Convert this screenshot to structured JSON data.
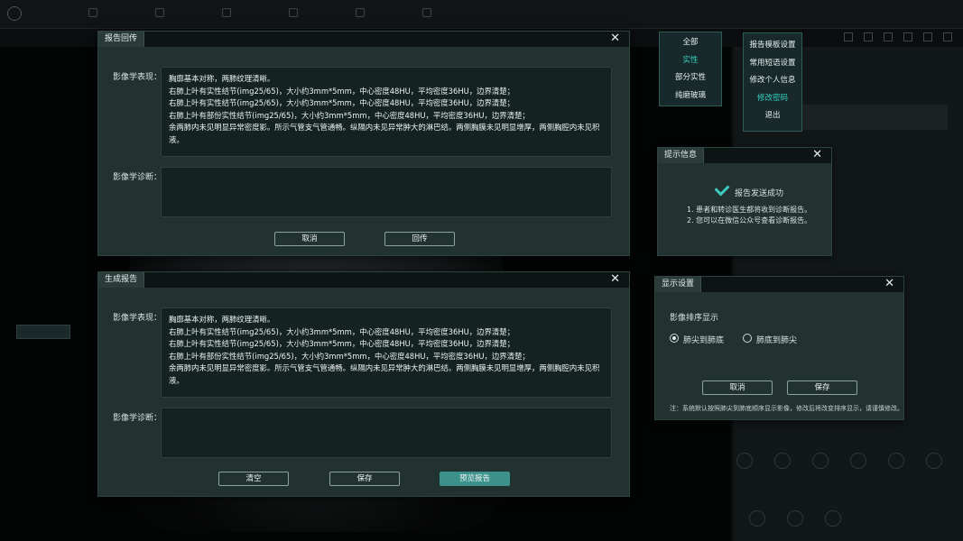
{
  "report_return": {
    "title": "报告回传",
    "findings_label": "影像学表现：",
    "findings_lines": [
      "胸廓基本对称，两肺纹理清晰。",
      "右肺上叶有实性结节(img25/65)，大小约3mm*5mm，中心密度48HU，平均密度36HU，边界清楚；",
      "右肺上叶有实性结节(img25/65)，大小约3mm*5mm，中心密度48HU，平均密度36HU，边界清楚；",
      "右肺上叶有部份实性结节(img25/65)，大小约3mm*5mm，中心密度48HU，平均密度36HU，边界清楚；",
      "余两肺内未见明显异常密度影。所示气管支气管通畅。纵隔内未见异常肿大的淋巴结。两侧胸膜未见明显增厚，两侧胸腔内未见积液。"
    ],
    "diagnosis_label": "影像学诊断：",
    "cancel": "取消",
    "return_btn": "回传"
  },
  "generate_report": {
    "title": "生成报告",
    "findings_label": "影像学表现：",
    "findings_lines": [
      "胸廓基本对称，两肺纹理清晰。",
      "右肺上叶有实性结节(img25/65)，大小约3mm*5mm，中心密度48HU，平均密度36HU，边界清楚；",
      "右肺上叶有实性结节(img25/65)，大小约3mm*5mm，中心密度48HU，平均密度36HU，边界清楚；",
      "右肺上叶有部份实性结节(img25/65)，大小约3mm*5mm，中心密度48HU，平均密度36HU，边界清楚；",
      "余两肺内未见明显异常密度影。所示气管支气管通畅。纵隔内未见异常肿大的淋巴结。两侧胸膜未见明显增厚，两侧胸腔内未见积液。"
    ],
    "diagnosis_label": "影像学诊断：",
    "clear": "清空",
    "save": "保存",
    "preview": "预览报告"
  },
  "filter_menu": {
    "items": [
      "全部",
      "实性",
      "部分实性",
      "纯磨玻璃"
    ],
    "active_index": 1
  },
  "user_menu": {
    "items": [
      "报告模板设置",
      "常用短语设置",
      "修改个人信息",
      "修改密码",
      "退出"
    ],
    "active_index": 3
  },
  "notice": {
    "title": "提示信息",
    "message": "报告发送成功",
    "lines": [
      "1. 患者和转诊医生都将收到诊断报告。",
      "2. 您可以在微信公众号查看诊断报告。"
    ],
    "colors": {
      "check": "#3ec9c0"
    }
  },
  "display_settings": {
    "title": "显示设置",
    "section": "影像排序显示",
    "options": [
      "肺尖到肺底",
      "肺底到肺尖"
    ],
    "selected_index": 0,
    "cancel": "取消",
    "save": "保存",
    "note": "注：系统默认按照肺尖到肺底顺序显示影像，修改后将改变排序显示，请谨慎修改。"
  },
  "colors": {
    "accent": "#3c918b",
    "dialog_bg": "#213230",
    "menu_active": "#36d2c4"
  }
}
